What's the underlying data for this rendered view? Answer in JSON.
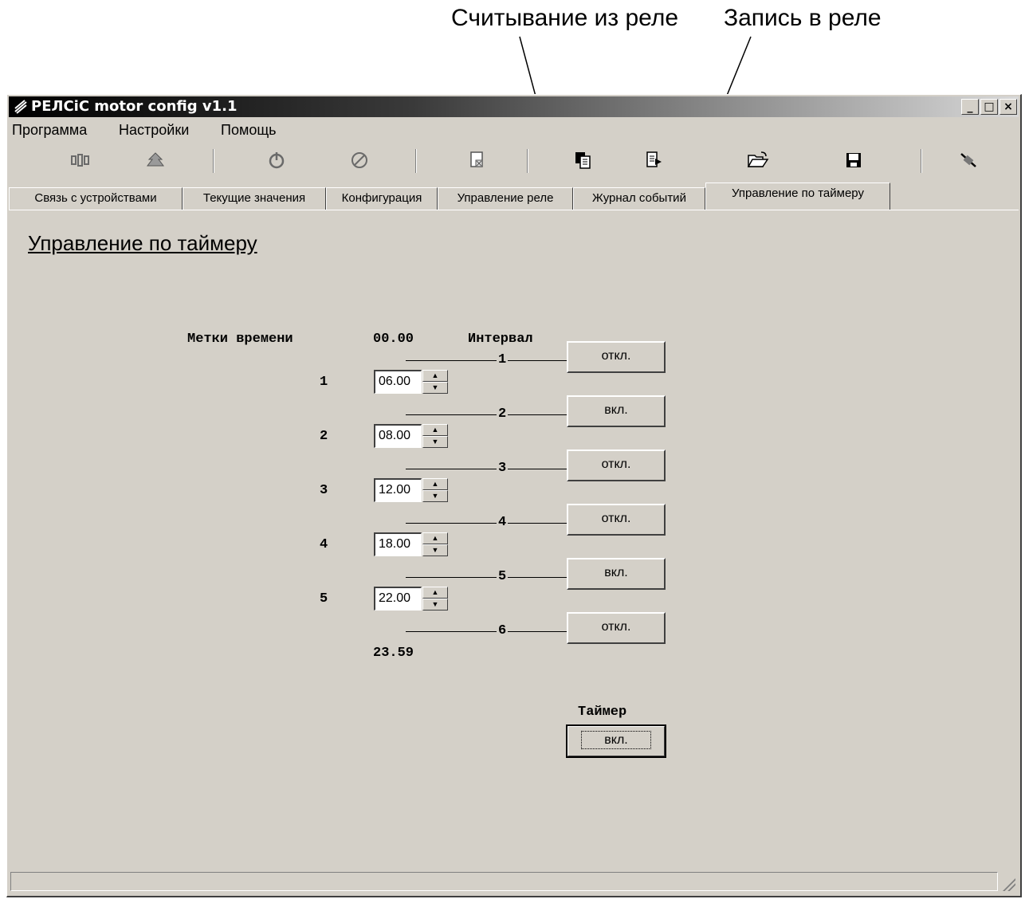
{
  "annotations": {
    "read_label": "Считывание из реле",
    "write_label": "Запись в реле"
  },
  "window": {
    "title": "РЕЛСiС motor config v1.1",
    "controls": [
      "_",
      "□",
      "×"
    ]
  },
  "menu": [
    "Программа",
    "Настройки",
    "Помощь"
  ],
  "toolbar_icons": [
    "network-icon",
    "device-icon",
    "power-icon",
    "stop-icon",
    "clear-icon",
    "read-from-relay-icon",
    "write-to-relay-icon",
    "open-folder-icon",
    "save-icon",
    "disconnect-icon"
  ],
  "tabs": [
    "Связь с устройствами",
    "Текущие значения",
    "Конфигурация",
    "Управление реле",
    "Журнал событий",
    "Управление по таймеру"
  ],
  "active_tab": "Управление по таймеру",
  "page": {
    "heading": "Управление по таймеру",
    "col_marks": "Метки времени",
    "start_time": "00.00",
    "col_interval": "Интервал",
    "end_time": "23.59",
    "marks": [
      {
        "index": "1",
        "value": "06.00"
      },
      {
        "index": "2",
        "value": "08.00"
      },
      {
        "index": "3",
        "value": "12.00"
      },
      {
        "index": "4",
        "value": "18.00"
      },
      {
        "index": "5",
        "value": "22.00"
      }
    ],
    "intervals": [
      {
        "num": "1",
        "state": "откл."
      },
      {
        "num": "2",
        "state": "вкл."
      },
      {
        "num": "3",
        "state": "откл."
      },
      {
        "num": "4",
        "state": "откл."
      },
      {
        "num": "5",
        "state": "вкл."
      },
      {
        "num": "6",
        "state": "откл."
      }
    ],
    "timer_label": "Таймер",
    "timer_state": "вкл."
  },
  "colors": {
    "face": "#d4d0c8",
    "titlebar": "#000000"
  }
}
